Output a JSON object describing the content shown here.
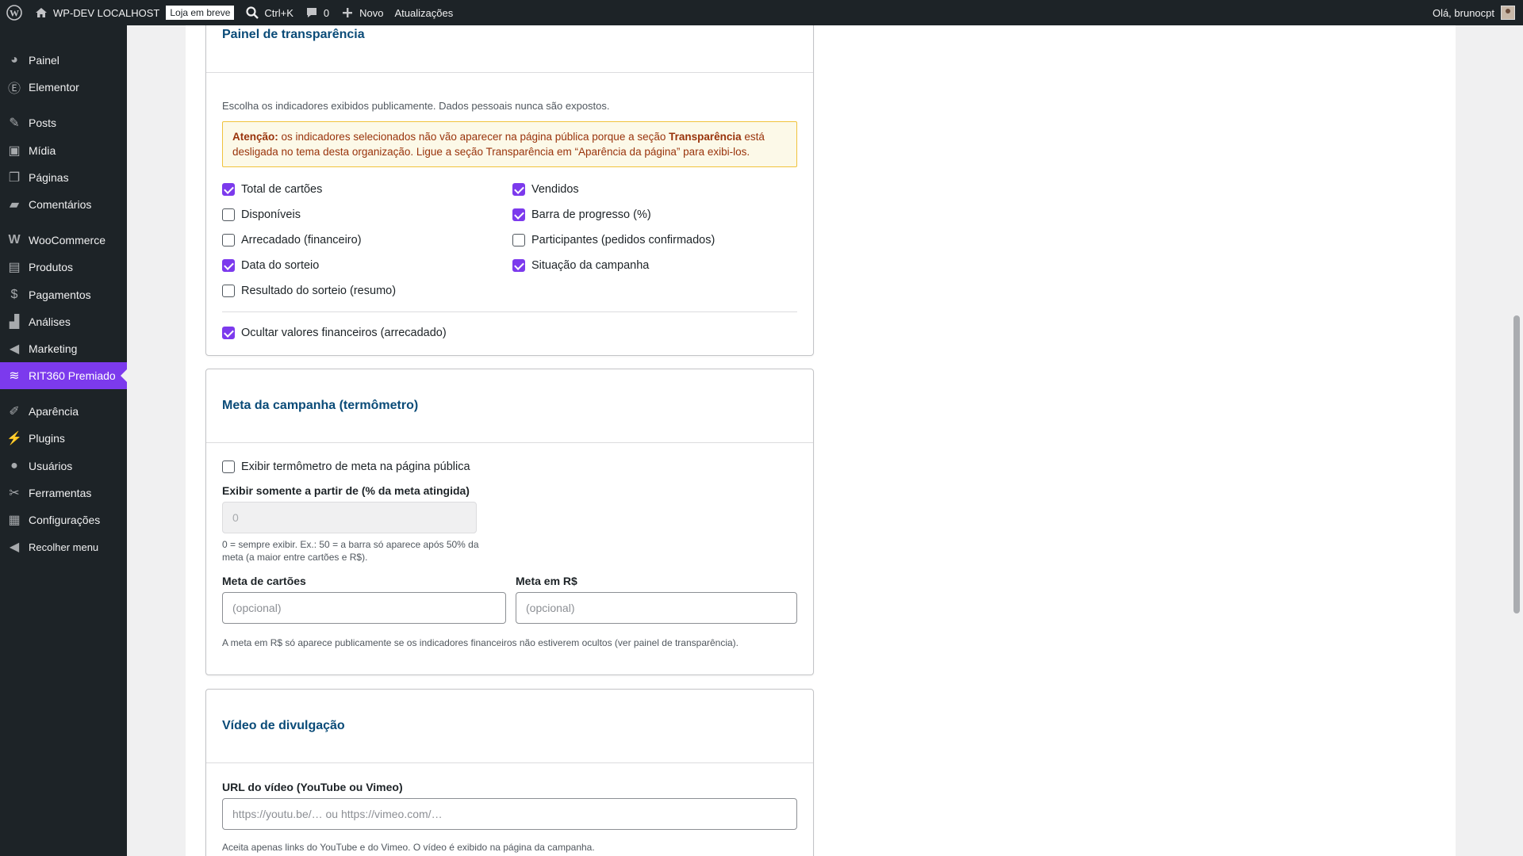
{
  "adminbar": {
    "site_name": "WP-DEV LOCALHOST",
    "badge": "Loja em breve",
    "search_shortcut": "Ctrl+K",
    "comments_count": "0",
    "new_label": "Novo",
    "updates_label": "Atualizações",
    "greeting": "Olá, brunocpt"
  },
  "sidebar": {
    "items": [
      {
        "label": "Painel",
        "icon": "dashboard-icon"
      },
      {
        "label": "Elementor",
        "icon": "elementor-icon"
      },
      {
        "label": "Posts",
        "icon": "pin-icon"
      },
      {
        "label": "Mídia",
        "icon": "media-icon"
      },
      {
        "label": "Páginas",
        "icon": "pages-icon"
      },
      {
        "label": "Comentários",
        "icon": "comment-icon"
      },
      {
        "label": "WooCommerce",
        "icon": "woo-icon"
      },
      {
        "label": "Produtos",
        "icon": "archive-icon"
      },
      {
        "label": "Pagamentos",
        "icon": "money-icon"
      },
      {
        "label": "Análises",
        "icon": "chart-bar-icon"
      },
      {
        "label": "Marketing",
        "icon": "megaphone-icon"
      },
      {
        "label": "RIT360 Premiado",
        "icon": "tickets-icon"
      },
      {
        "label": "Aparência",
        "icon": "brush-icon"
      },
      {
        "label": "Plugins",
        "icon": "plugin-icon"
      },
      {
        "label": "Usuários",
        "icon": "user-icon"
      },
      {
        "label": "Ferramentas",
        "icon": "wrench-icon"
      },
      {
        "label": "Configurações",
        "icon": "settings-icon"
      },
      {
        "label": "Recolher menu",
        "icon": "collapse-icon"
      }
    ]
  },
  "transparency": {
    "title": "Painel de transparência",
    "description": "Escolha os indicadores exibidos publicamente. Dados pessoais nunca são expostos.",
    "notice_strong": "Atenção:",
    "notice_text_1": " os indicadores selecionados não vão aparecer na página pública porque a seção ",
    "notice_section": "Transparência",
    "notice_text_2": " está desligada no tema desta organização. Ligue a seção Transparência em “Aparência da página” para exibi-los.",
    "options": [
      {
        "label": "Total de cartões",
        "checked": true
      },
      {
        "label": "Vendidos",
        "checked": true
      },
      {
        "label": "Disponíveis",
        "checked": false
      },
      {
        "label": "Barra de progresso (%)",
        "checked": true
      },
      {
        "label": "Arrecadado (financeiro)",
        "checked": false
      },
      {
        "label": "Participantes (pedidos confirmados)",
        "checked": false
      },
      {
        "label": "Data do sorteio",
        "checked": true
      },
      {
        "label": "Situação da campanha",
        "checked": true
      },
      {
        "label": "Resultado do sorteio (resumo)",
        "checked": false
      }
    ],
    "hide_financial": {
      "label": "Ocultar valores financeiros (arrecadado)",
      "checked": true
    }
  },
  "goal": {
    "title": "Meta da campanha (termômetro)",
    "show_thermometer": {
      "label": "Exibir termômetro de meta na página pública",
      "checked": false
    },
    "threshold_label": "Exibir somente a partir de (% da meta atingida)",
    "threshold_value": "0",
    "threshold_help": "0 = sempre exibir. Ex.: 50 = a barra só aparece após 50% da meta (a maior entre cartões e R$).",
    "cards_goal_label": "Meta de cartões",
    "cards_goal_placeholder": "(opcional)",
    "money_goal_label": "Meta em R$",
    "money_goal_placeholder": "(opcional)",
    "money_help": "A meta em R$ só aparece publicamente se os indicadores financeiros não estiverem ocultos (ver painel de transparência)."
  },
  "video": {
    "title": "Vídeo de divulgação",
    "url_label": "URL do vídeo (YouTube ou Vimeo)",
    "url_placeholder": "https://youtu.be/… ou https://vimeo.com/…",
    "help": "Aceita apenas links do YouTube e do Vimeo. O vídeo é exibido na página da campanha."
  },
  "colors": {
    "accent": "#7c3aed",
    "adminbar": "#1d2327",
    "title": "#0a4b78"
  }
}
